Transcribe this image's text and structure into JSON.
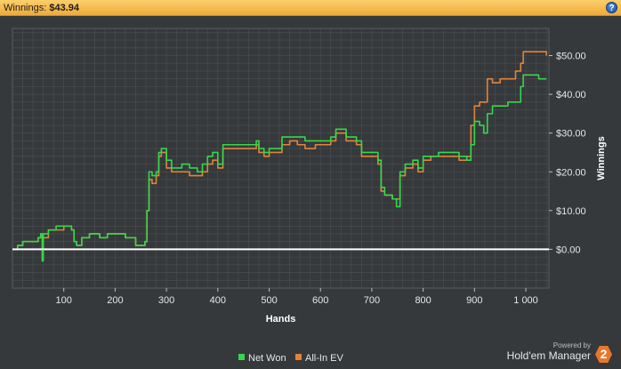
{
  "header": {
    "label": "Winnings:",
    "value": "$43.94",
    "help_glyph": "?",
    "help_icon": "help-icon"
  },
  "brand": {
    "powered_by": "Powered by",
    "name": "Hold'em Manager",
    "badge": "2"
  },
  "colors": {
    "net_won": "#35d84a",
    "all_in_ev": "#e0843d",
    "zero_line": "#ffffff",
    "grid": "#4c4f52",
    "plot_bg": "#36393b"
  },
  "chart_data": {
    "type": "line",
    "title": "",
    "xlabel": "Hands",
    "ylabel": "Winnings",
    "xlim": [
      0,
      1045
    ],
    "ylim": [
      -10,
      57
    ],
    "x_ticks": [
      100,
      200,
      300,
      400,
      500,
      600,
      700,
      800,
      900,
      1000
    ],
    "x_tick_labels": [
      "100",
      "200",
      "300",
      "400",
      "500",
      "600",
      "700",
      "800",
      "900",
      "1 000"
    ],
    "y_ticks": [
      0,
      10,
      20,
      30,
      40,
      50
    ],
    "y_tick_labels": [
      "$0.00",
      "$10.00",
      "$20.00",
      "$30.00",
      "$40.00",
      "$50.00"
    ],
    "grid": true,
    "legend": "bottom-center",
    "series": [
      {
        "name": "Net Won",
        "color": "#35d84a",
        "points": [
          [
            0,
            0
          ],
          [
            10,
            1
          ],
          [
            20,
            2
          ],
          [
            40,
            2
          ],
          [
            50,
            3
          ],
          [
            55,
            4
          ],
          [
            58,
            -3
          ],
          [
            60,
            4
          ],
          [
            70,
            5
          ],
          [
            85,
            6
          ],
          [
            100,
            6
          ],
          [
            115,
            5
          ],
          [
            120,
            2
          ],
          [
            125,
            1
          ],
          [
            135,
            3
          ],
          [
            150,
            4
          ],
          [
            170,
            3
          ],
          [
            185,
            4
          ],
          [
            200,
            4
          ],
          [
            220,
            3
          ],
          [
            235,
            3
          ],
          [
            240,
            1
          ],
          [
            250,
            1
          ],
          [
            258,
            2
          ],
          [
            262,
            10
          ],
          [
            266,
            20
          ],
          [
            272,
            19
          ],
          [
            280,
            20
          ],
          [
            285,
            25
          ],
          [
            290,
            26
          ],
          [
            300,
            23
          ],
          [
            310,
            21
          ],
          [
            330,
            22
          ],
          [
            345,
            21
          ],
          [
            360,
            20
          ],
          [
            370,
            22
          ],
          [
            380,
            24
          ],
          [
            390,
            25
          ],
          [
            400,
            22
          ],
          [
            410,
            27
          ],
          [
            425,
            27
          ],
          [
            440,
            27
          ],
          [
            460,
            27
          ],
          [
            475,
            28
          ],
          [
            480,
            26
          ],
          [
            490,
            25
          ],
          [
            500,
            26
          ],
          [
            515,
            26
          ],
          [
            525,
            29
          ],
          [
            540,
            29
          ],
          [
            555,
            29
          ],
          [
            570,
            28
          ],
          [
            590,
            28
          ],
          [
            610,
            28
          ],
          [
            620,
            29
          ],
          [
            630,
            31
          ],
          [
            650,
            29
          ],
          [
            670,
            28
          ],
          [
            680,
            25
          ],
          [
            700,
            25
          ],
          [
            712,
            23
          ],
          [
            718,
            16
          ],
          [
            725,
            14
          ],
          [
            740,
            13
          ],
          [
            748,
            11
          ],
          [
            755,
            20
          ],
          [
            765,
            22
          ],
          [
            780,
            23
          ],
          [
            790,
            21
          ],
          [
            800,
            24
          ],
          [
            815,
            24
          ],
          [
            830,
            25
          ],
          [
            855,
            25
          ],
          [
            870,
            24
          ],
          [
            885,
            23
          ],
          [
            893,
            27
          ],
          [
            900,
            33
          ],
          [
            910,
            32
          ],
          [
            918,
            30
          ],
          [
            925,
            35
          ],
          [
            935,
            37
          ],
          [
            950,
            37
          ],
          [
            965,
            38
          ],
          [
            980,
            38
          ],
          [
            990,
            42
          ],
          [
            995,
            45
          ],
          [
            1010,
            45
          ],
          [
            1025,
            44
          ],
          [
            1040,
            44
          ]
        ]
      },
      {
        "name": "All-In EV",
        "color": "#e0843d",
        "points": [
          [
            0,
            0
          ],
          [
            10,
            1
          ],
          [
            20,
            2
          ],
          [
            40,
            2
          ],
          [
            50,
            3
          ],
          [
            60,
            3
          ],
          [
            70,
            5
          ],
          [
            85,
            5
          ],
          [
            100,
            6
          ],
          [
            115,
            5
          ],
          [
            120,
            2
          ],
          [
            125,
            1
          ],
          [
            135,
            3
          ],
          [
            150,
            4
          ],
          [
            170,
            3
          ],
          [
            185,
            4
          ],
          [
            200,
            4
          ],
          [
            220,
            3
          ],
          [
            235,
            3
          ],
          [
            240,
            1
          ],
          [
            250,
            1
          ],
          [
            258,
            2
          ],
          [
            262,
            10
          ],
          [
            266,
            18
          ],
          [
            272,
            17
          ],
          [
            280,
            19
          ],
          [
            285,
            24
          ],
          [
            290,
            25
          ],
          [
            300,
            21
          ],
          [
            310,
            20
          ],
          [
            330,
            20
          ],
          [
            345,
            19
          ],
          [
            360,
            19
          ],
          [
            370,
            20
          ],
          [
            380,
            22
          ],
          [
            390,
            23
          ],
          [
            400,
            21
          ],
          [
            410,
            26
          ],
          [
            425,
            26
          ],
          [
            440,
            26
          ],
          [
            460,
            26
          ],
          [
            475,
            27
          ],
          [
            480,
            25
          ],
          [
            490,
            24
          ],
          [
            500,
            25
          ],
          [
            515,
            25
          ],
          [
            525,
            27
          ],
          [
            540,
            28
          ],
          [
            555,
            27
          ],
          [
            570,
            26
          ],
          [
            590,
            27
          ],
          [
            610,
            27
          ],
          [
            620,
            28
          ],
          [
            630,
            30
          ],
          [
            650,
            28
          ],
          [
            670,
            27
          ],
          [
            680,
            24
          ],
          [
            700,
            24
          ],
          [
            712,
            22
          ],
          [
            718,
            15
          ],
          [
            725,
            14
          ],
          [
            740,
            13
          ],
          [
            748,
            13
          ],
          [
            755,
            19
          ],
          [
            765,
            21
          ],
          [
            780,
            22
          ],
          [
            790,
            20
          ],
          [
            800,
            23
          ],
          [
            815,
            24
          ],
          [
            830,
            24
          ],
          [
            855,
            24
          ],
          [
            870,
            23
          ],
          [
            885,
            24
          ],
          [
            893,
            32
          ],
          [
            900,
            37
          ],
          [
            910,
            38
          ],
          [
            918,
            38
          ],
          [
            925,
            44
          ],
          [
            935,
            43
          ],
          [
            950,
            44
          ],
          [
            965,
            44
          ],
          [
            980,
            46
          ],
          [
            990,
            48
          ],
          [
            995,
            51
          ],
          [
            1010,
            51
          ],
          [
            1025,
            51
          ],
          [
            1040,
            50
          ]
        ]
      }
    ]
  }
}
